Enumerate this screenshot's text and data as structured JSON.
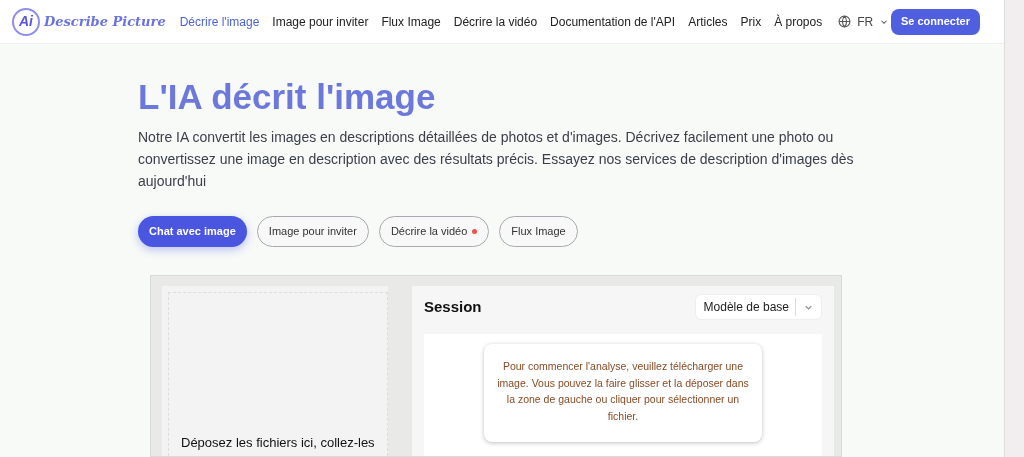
{
  "header": {
    "logo_badge": "Ai",
    "logo_text": "Describe Picture",
    "nav": [
      {
        "label": "Décrire l'image",
        "selected": true
      },
      {
        "label": "Image pour inviter",
        "selected": false
      },
      {
        "label": "Flux Image",
        "selected": false
      },
      {
        "label": "Décrire la vidéo",
        "selected": false
      },
      {
        "label": "Documentation de l'API",
        "selected": false
      },
      {
        "label": "Articles",
        "selected": false
      },
      {
        "label": "Prix",
        "selected": false
      },
      {
        "label": "À propos",
        "selected": false
      }
    ],
    "language": "FR",
    "login": "Se connecter"
  },
  "hero": {
    "title": "L'IA décrit l'image",
    "description": "Notre IA convertit les images en descriptions détaillées de photos et d'images. Décrivez facilement une photo ou convertissez une image en description avec des résultats précis. Essayez nos services de description d'images dès aujourd'hui"
  },
  "tabs": [
    {
      "label": "Chat avec image",
      "selected": true,
      "dot": false
    },
    {
      "label": "Image pour inviter",
      "selected": false,
      "dot": false
    },
    {
      "label": "Décrire la vidéo",
      "selected": false,
      "dot": true
    },
    {
      "label": "Flux Image",
      "selected": false,
      "dot": false
    }
  ],
  "upload": {
    "hint": "Déposez les fichiers ici, collez-les"
  },
  "session": {
    "title": "Session",
    "model": "Modèle de base",
    "message": "Pour commencer l'analyse, veuillez télécharger une image. Vous pouvez la faire glisser et la déposer dans la zone de gauche ou cliquer pour sélectionner un fichier."
  }
}
